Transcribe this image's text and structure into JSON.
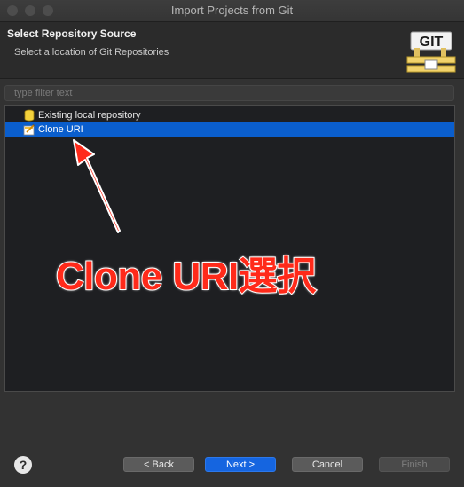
{
  "window": {
    "title": "Import Projects from Git"
  },
  "header": {
    "title": "Select Repository Source",
    "subtitle": "Select a location of Git Repositories",
    "logo_text": "GIT"
  },
  "filter": {
    "placeholder": "type filter text",
    "value": ""
  },
  "tree": {
    "items": [
      {
        "label": "Existing local repository",
        "icon": "database-icon",
        "selected": false
      },
      {
        "label": "Clone URI",
        "icon": "clone-uri-icon",
        "selected": true
      }
    ]
  },
  "annotation": {
    "text": "Clone URI選択",
    "color": "#ff2a1a"
  },
  "buttons": {
    "help": "?",
    "back": "< Back",
    "next": "Next >",
    "cancel": "Cancel",
    "finish": "Finish"
  },
  "colors": {
    "selection": "#0a5ecd",
    "primary_button": "#1565e0",
    "annotation_red": "#ff2a1a"
  }
}
